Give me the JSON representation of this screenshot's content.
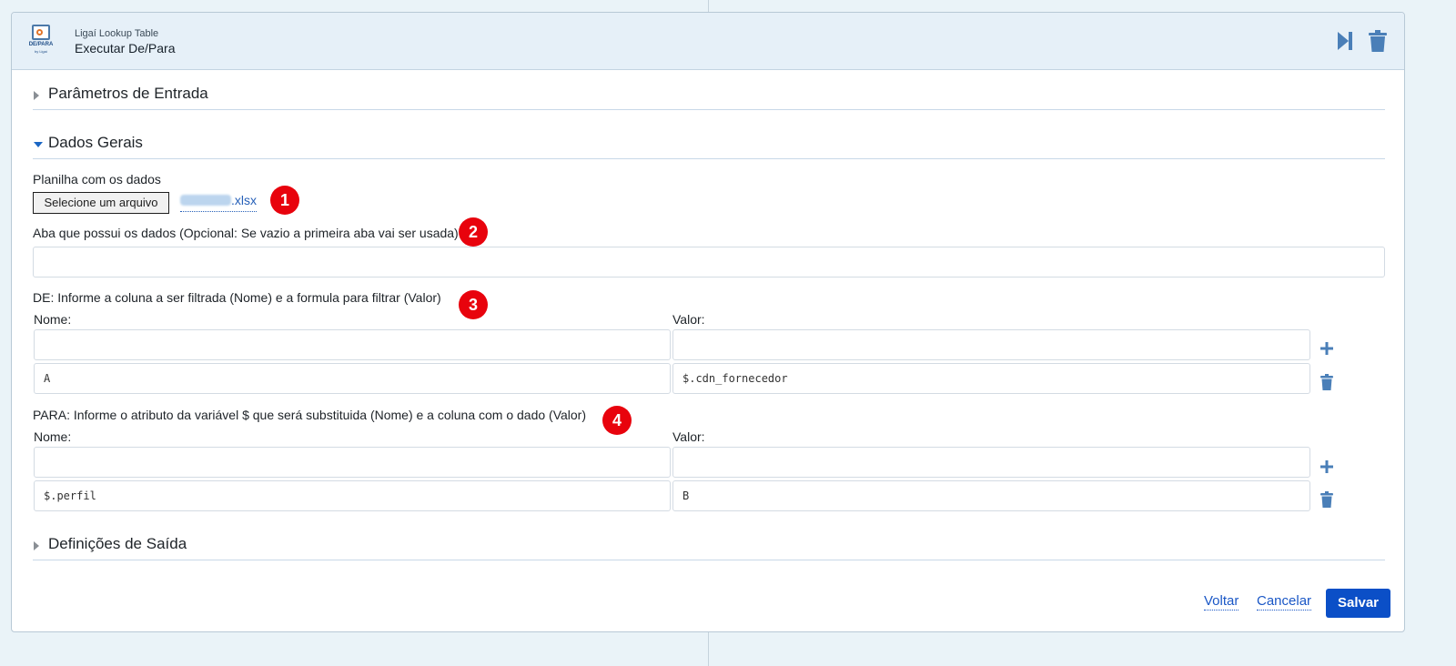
{
  "header": {
    "subtitle": "Ligaí Lookup Table",
    "title": "Executar De/Para",
    "logo_text": "DE/PARA",
    "logo_sub": "by Ligaí",
    "accent_color": "#4a7fb8"
  },
  "sections": {
    "entrada": "Parâmetros de Entrada",
    "gerais": "Dados Gerais",
    "saida": "Definições de Saída"
  },
  "planilha": {
    "label": "Planilha com os dados",
    "button": "Selecione um arquivo",
    "file_ext": ".xlsx"
  },
  "aba": {
    "label": "Aba que possui os dados (Opcional: Se vazio a primeira aba vai ser usada)",
    "value": ""
  },
  "de": {
    "label": "DE: Informe a coluna a ser filtrada (Nome) e a formula para filtrar (Valor)",
    "nome_label": "Nome:",
    "valor_label": "Valor:",
    "rows": [
      {
        "nome": "",
        "valor": ""
      },
      {
        "nome": "A",
        "valor": "$.cdn_fornecedor"
      }
    ]
  },
  "para": {
    "label": "PARA: Informe o atributo da variável $ que será substituida (Nome) e a coluna com o dado (Valor)",
    "nome_label": "Nome:",
    "valor_label": "Valor:",
    "rows": [
      {
        "nome": "",
        "valor": ""
      },
      {
        "nome": "$.perfil",
        "valor": "B"
      }
    ]
  },
  "badges": [
    "1",
    "2",
    "3",
    "4"
  ],
  "footer": {
    "back": "Voltar",
    "cancel": "Cancelar",
    "save": "Salvar"
  },
  "icons": {
    "run": "skip-forward-icon",
    "delete": "trash-icon",
    "add": "plus-icon",
    "expand": "caret-right-icon",
    "collapse": "caret-down-icon"
  }
}
